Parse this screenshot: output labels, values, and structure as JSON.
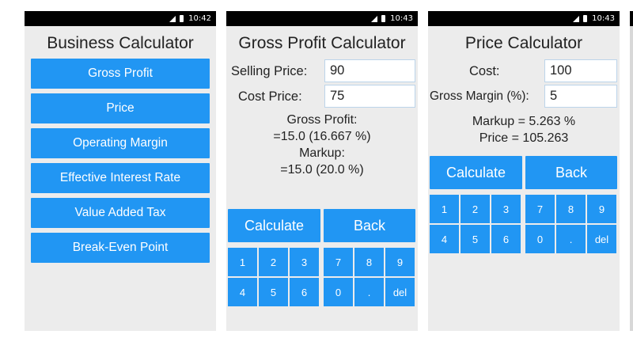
{
  "screens": [
    {
      "time": "10:42",
      "title": "Business Calculator",
      "menu": [
        "Gross Profit",
        "Price",
        "Operating Margin",
        "Effective Interest Rate",
        "Value Added Tax",
        "Break-Even Point"
      ]
    },
    {
      "time": "10:43",
      "title": "Gross Profit Calculator",
      "selling_label": "Selling Price:",
      "selling_value": "90",
      "cost_label": "Cost Price:",
      "cost_value": "75",
      "result_lines": [
        "Gross Profit:",
        "=15.0 (16.667 %)",
        "Markup:",
        "=15.0 (20.0 %)"
      ],
      "calculate_label": "Calculate",
      "back_label": "Back",
      "keys_left": [
        "1",
        "2",
        "3",
        "4",
        "5",
        "6"
      ],
      "keys_right": [
        "7",
        "8",
        "9",
        "0",
        ".",
        "del"
      ]
    },
    {
      "time": "10:43",
      "title": "Price Calculator",
      "cost_label": "Cost:",
      "cost_value": "100",
      "margin_label": "Gross Margin (%):",
      "margin_value": "5",
      "result_lines": [
        "Markup = 5.263 %",
        "Price = 105.263"
      ],
      "calculate_label": "Calculate",
      "back_label": "Back",
      "keys_left": [
        "1",
        "2",
        "3",
        "4",
        "5",
        "6"
      ],
      "keys_right": [
        "7",
        "8",
        "9",
        "0",
        ".",
        "del"
      ]
    }
  ],
  "colors": {
    "accent": "#2196f3",
    "screen_bg": "#ececec",
    "status_bar": "#000000"
  },
  "icons": [
    "signal-icon",
    "battery-icon"
  ]
}
